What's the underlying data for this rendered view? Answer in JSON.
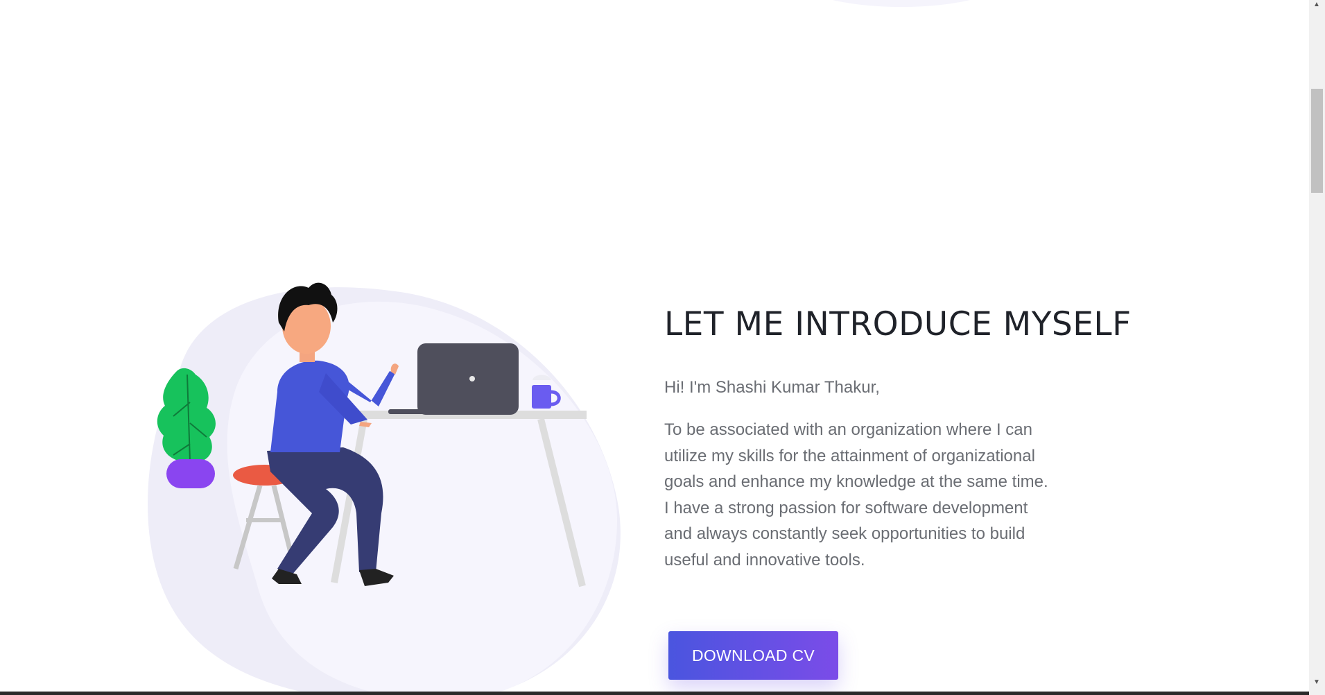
{
  "intro": {
    "heading": "LET ME INTRODUCE MYSELF",
    "greeting": "Hi! I'm Shashi Kumar Thakur,",
    "paragraph": "To be associated with an organization where I can utilize my skills for the attainment of organizational goals and enhance my knowledge at the same time. I have a strong passion for software development and always constantly seek opportunities to build useful and innovative tools.",
    "button_label": "DOWNLOAD CV"
  },
  "icons": {
    "scroll_up": "scroll-up-arrow-icon",
    "scroll_down": "scroll-down-arrow-icon",
    "illustration": "person-working-at-laptop-illustration"
  },
  "colors": {
    "heading": "#1f2229",
    "body_text": "#6a6d73",
    "button_start": "#4a55df",
    "button_end": "#7b4ce8",
    "blob": "#f5f4fc"
  }
}
